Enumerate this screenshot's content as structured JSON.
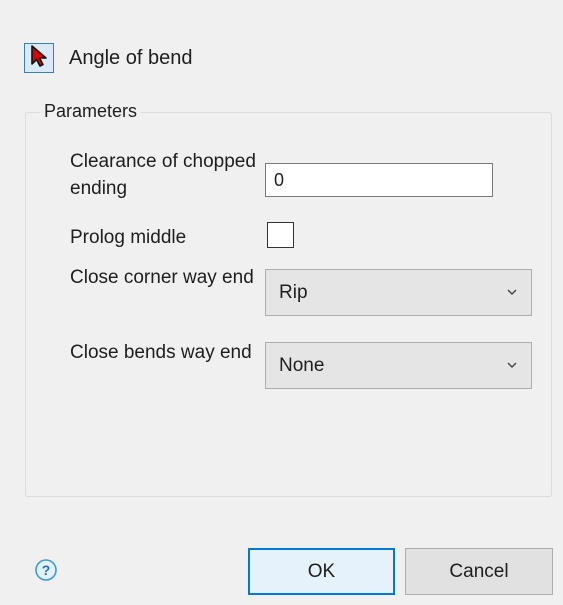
{
  "header": {
    "title": "Angle of bend",
    "tool_icon": "red-arrow-cursor-icon"
  },
  "parameters": {
    "group_title": "Parameters",
    "clearance": {
      "label": "Clearance of chopped ending",
      "value": "0"
    },
    "prolog_middle": {
      "label": "Prolog middle",
      "checked": false
    },
    "close_corner": {
      "label": "Close corner way end",
      "value": "Rip"
    },
    "close_bends": {
      "label": "Close bends way end",
      "value": "None"
    }
  },
  "footer": {
    "help_icon": "question-circle-icon",
    "ok_label": "OK",
    "cancel_label": "Cancel"
  },
  "colors": {
    "accent": "#0078d7",
    "tool_cursor": "#e00000",
    "help_icon": "#3a9ad9"
  }
}
